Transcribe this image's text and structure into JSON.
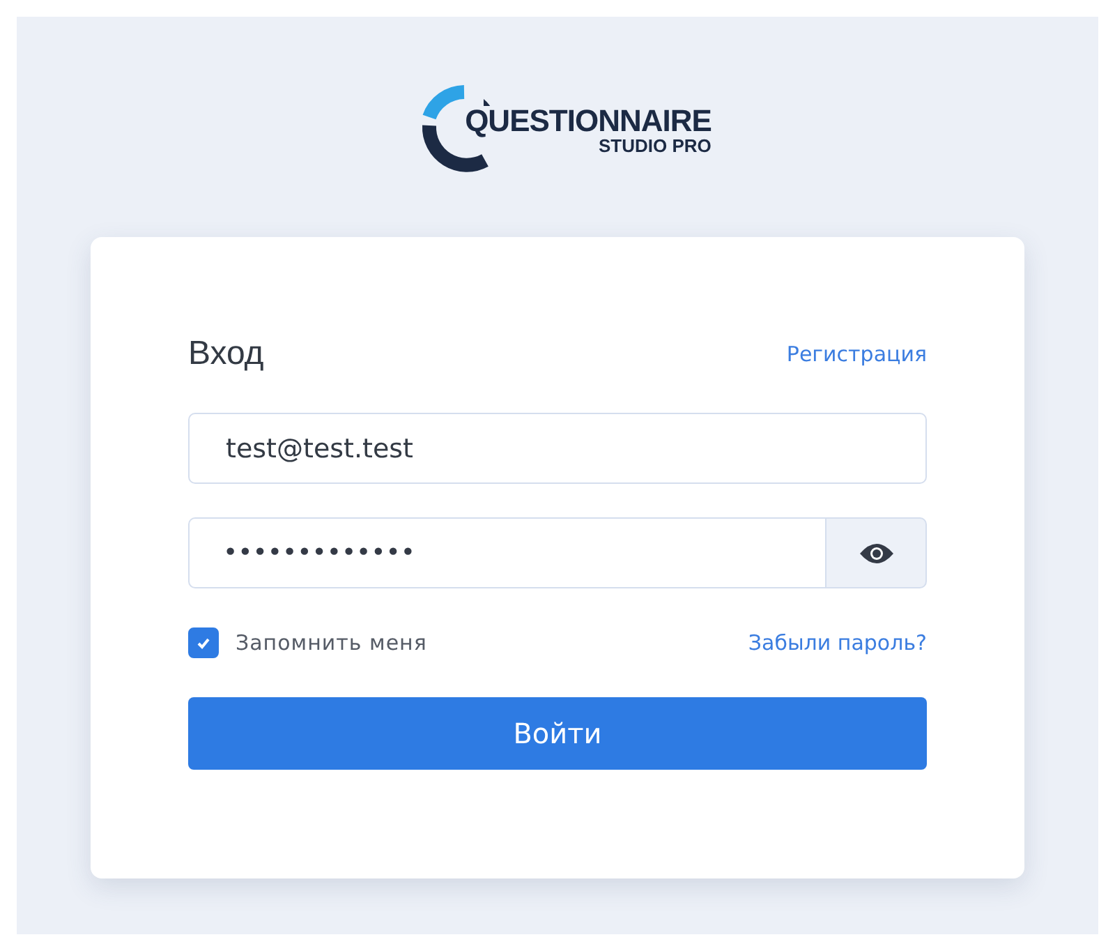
{
  "logo": {
    "title": "QUESTIONNAIRE",
    "subtitle": "STUDIO PRO"
  },
  "login": {
    "heading": "Вход",
    "register_link": "Регистрация",
    "email_field": {
      "value": "test@test.test"
    },
    "password_field": {
      "value": "•••••••••••••"
    },
    "remember": {
      "label": "Запомнить меня",
      "checked": true
    },
    "forgot_link": "Забыли пароль?",
    "submit": "Войти"
  }
}
